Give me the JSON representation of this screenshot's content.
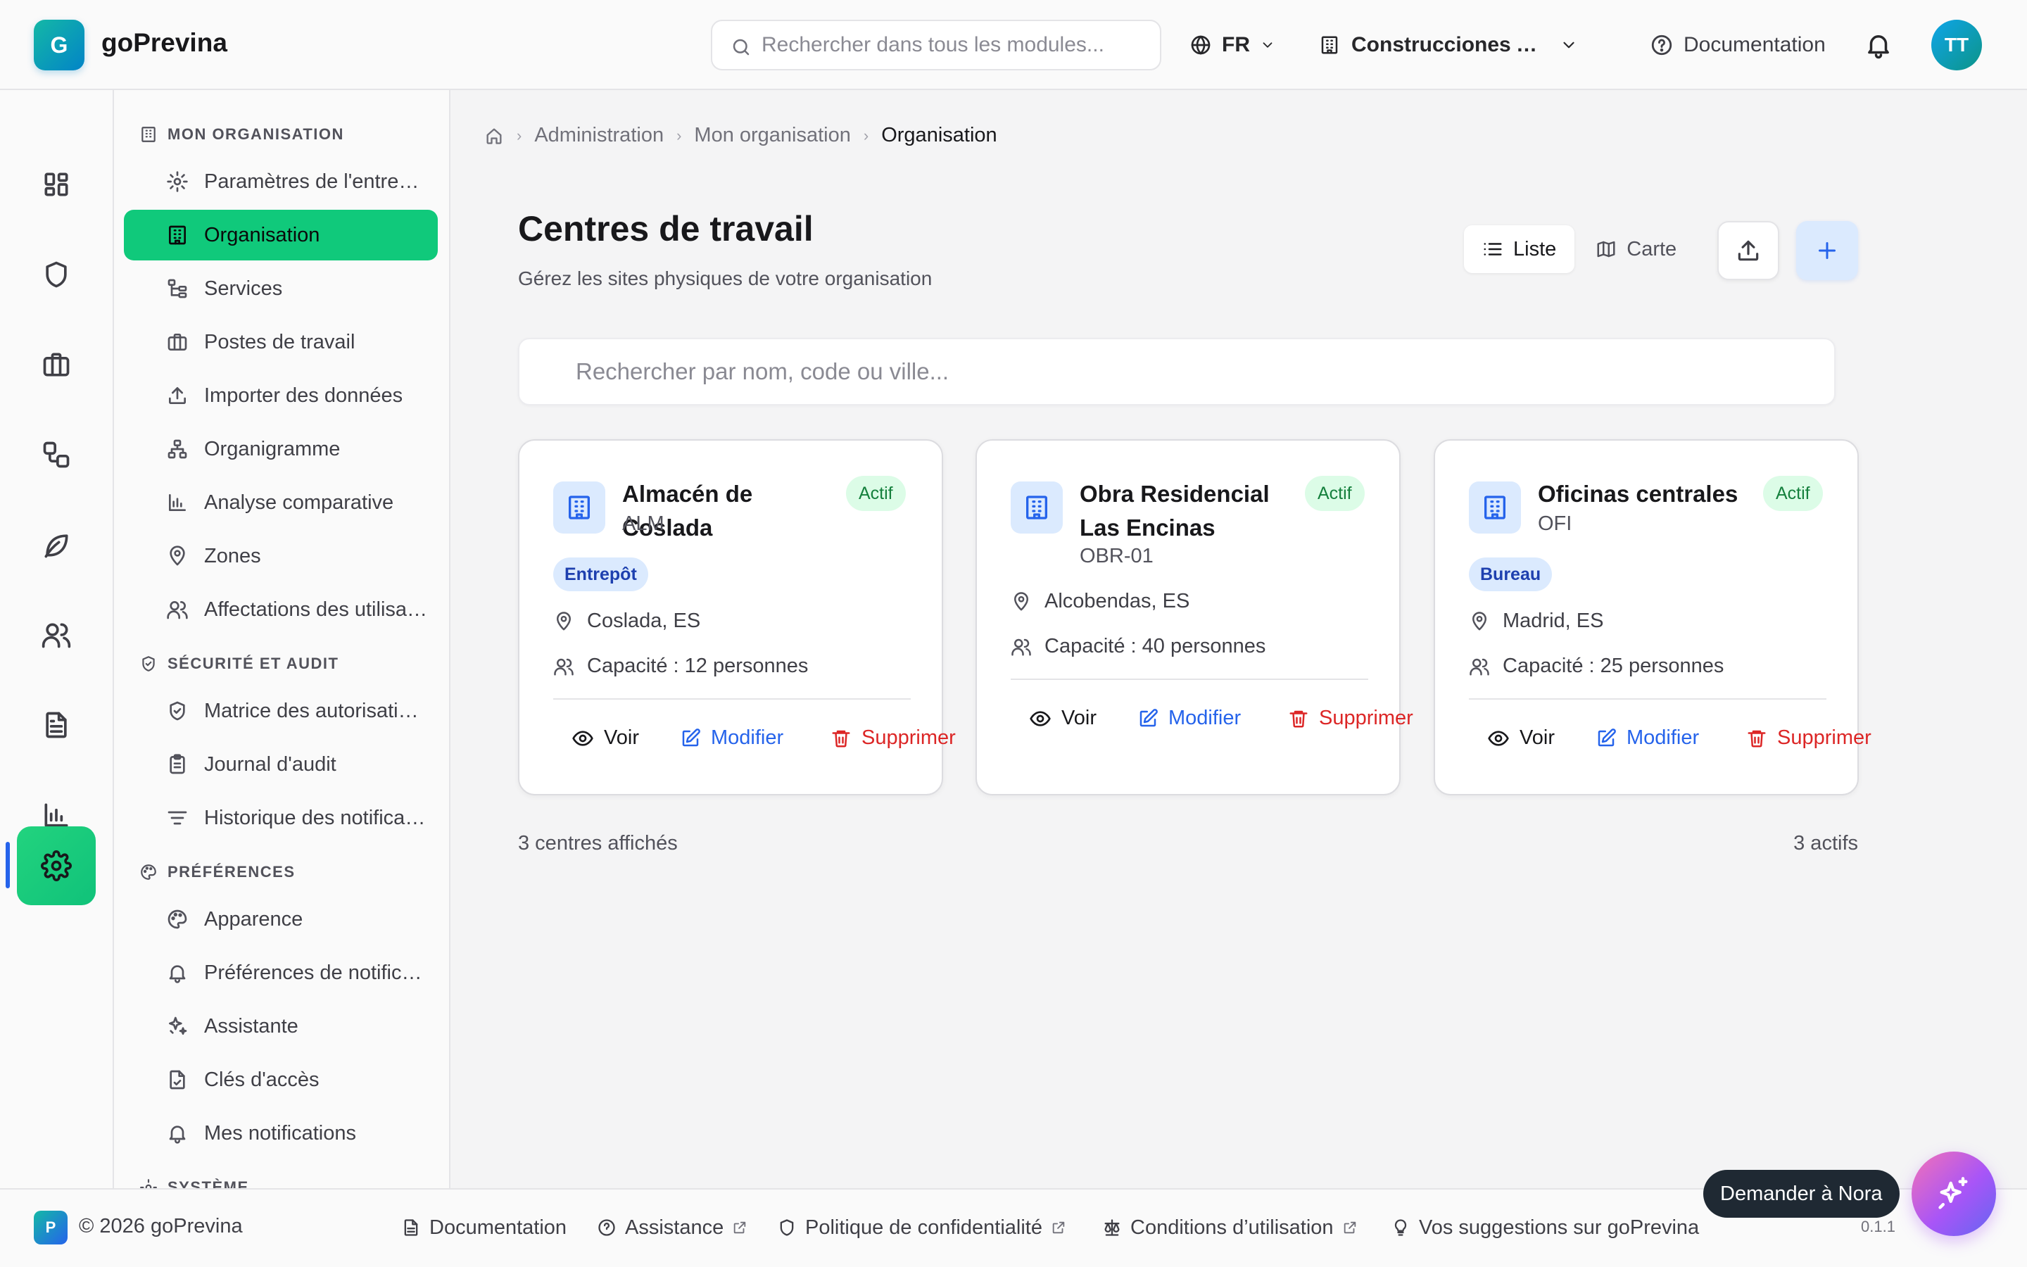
{
  "app": {
    "logo_letter": "G",
    "name": "goPrevina"
  },
  "header": {
    "search_placeholder": "Rechercher dans tous les modules...",
    "language": "FR",
    "company": "Construcciones Acme S.L.",
    "docs_label": "Documentation",
    "user_initials": "TT"
  },
  "rail": {
    "items": [
      {
        "name": "dashboard",
        "icon": "layout-grid-icon"
      },
      {
        "name": "security",
        "icon": "shield-icon"
      },
      {
        "name": "briefcase",
        "icon": "briefcase-icon"
      },
      {
        "name": "workflow",
        "icon": "workflow-icon"
      },
      {
        "name": "environment",
        "icon": "leaf-icon"
      },
      {
        "name": "people",
        "icon": "users-icon"
      },
      {
        "name": "documents",
        "icon": "file-text-icon"
      },
      {
        "name": "reports",
        "icon": "bar-chart-icon"
      },
      {
        "name": "settings",
        "icon": "gear-icon",
        "active": true
      }
    ]
  },
  "nav": {
    "groups": [
      {
        "title": "Mon organisation",
        "items": [
          {
            "label": "Paramètres de l'entreprise",
            "icon": "gear-icon"
          },
          {
            "label": "Organisation",
            "icon": "building-icon",
            "active": true
          },
          {
            "label": "Services",
            "icon": "hierarchy-icon"
          },
          {
            "label": "Postes de travail",
            "icon": "briefcase-icon"
          },
          {
            "label": "Importer des données",
            "icon": "upload-icon"
          },
          {
            "label": "Organigramme",
            "icon": "org-chart-icon"
          },
          {
            "label": "Analyse comparative",
            "icon": "bar-chart-icon"
          },
          {
            "label": "Zones",
            "icon": "map-pin-icon"
          },
          {
            "label": "Affectations des utilisateurs",
            "icon": "users-icon"
          }
        ]
      },
      {
        "title": "Sécurité et audit",
        "items": [
          {
            "label": "Matrice des autorisations",
            "icon": "shield-check-icon"
          },
          {
            "label": "Journal d'audit",
            "icon": "clipboard-icon"
          },
          {
            "label": "Historique des notifications",
            "icon": "filter-lines-icon"
          }
        ]
      },
      {
        "title": "Préférences",
        "items": [
          {
            "label": "Apparence",
            "icon": "palette-icon"
          },
          {
            "label": "Préférences de notification",
            "icon": "bell-icon"
          },
          {
            "label": "Assistante",
            "icon": "sparkles-icon"
          },
          {
            "label": "Clés d'accès",
            "icon": "key-file-icon"
          },
          {
            "label": "Mes notifications",
            "icon": "bell-icon"
          }
        ]
      },
      {
        "title": "Système",
        "items": []
      }
    ]
  },
  "breadcrumb": {
    "items": [
      "Administration",
      "Mon organisation"
    ],
    "current": "Organisation"
  },
  "page": {
    "title": "Centres de travail",
    "subtitle": "Gérez les sites physiques de votre organisation",
    "view_list": "Liste",
    "view_map": "Carte",
    "active_view": "Liste",
    "search_placeholder": "Rechercher par nom, code ou ville..."
  },
  "cards": [
    {
      "name": "Almacén de Coslada",
      "code": "ALM",
      "status": "Actif",
      "type": "Entrepôt",
      "location": "Coslada, ES",
      "capacity": "Capacité : 12 personnes"
    },
    {
      "name": "Obra Residencial Las Encinas",
      "code": "OBR-01",
      "status": "Actif",
      "type": "",
      "location": "Alcobendas, ES",
      "capacity": "Capacité : 40 personnes"
    },
    {
      "name": "Oficinas centrales",
      "code": "OFI",
      "status": "Actif",
      "type": "Bureau",
      "location": "Madrid, ES",
      "capacity": "Capacité : 25 personnes"
    }
  ],
  "card_actions": {
    "view": "Voir",
    "edit": "Modifier",
    "delete": "Supprimer"
  },
  "summary": {
    "shown": "3 centres affichés",
    "active": "3 actifs"
  },
  "footer": {
    "logo_letter": "P",
    "copyright": "© 2026 goPrevina",
    "links": [
      "Documentation",
      "Assistance",
      "Politique de confidentialité",
      "Conditions d’utilisation",
      "Vos suggestions sur goPrevina"
    ],
    "version": "0.1.1"
  },
  "assistant": {
    "tooltip": "Demander à Nora"
  },
  "colors": {
    "accent": "#10c97b",
    "primary": "#2563eb",
    "danger": "#dc2626",
    "success_bg": "#dcfce7"
  }
}
